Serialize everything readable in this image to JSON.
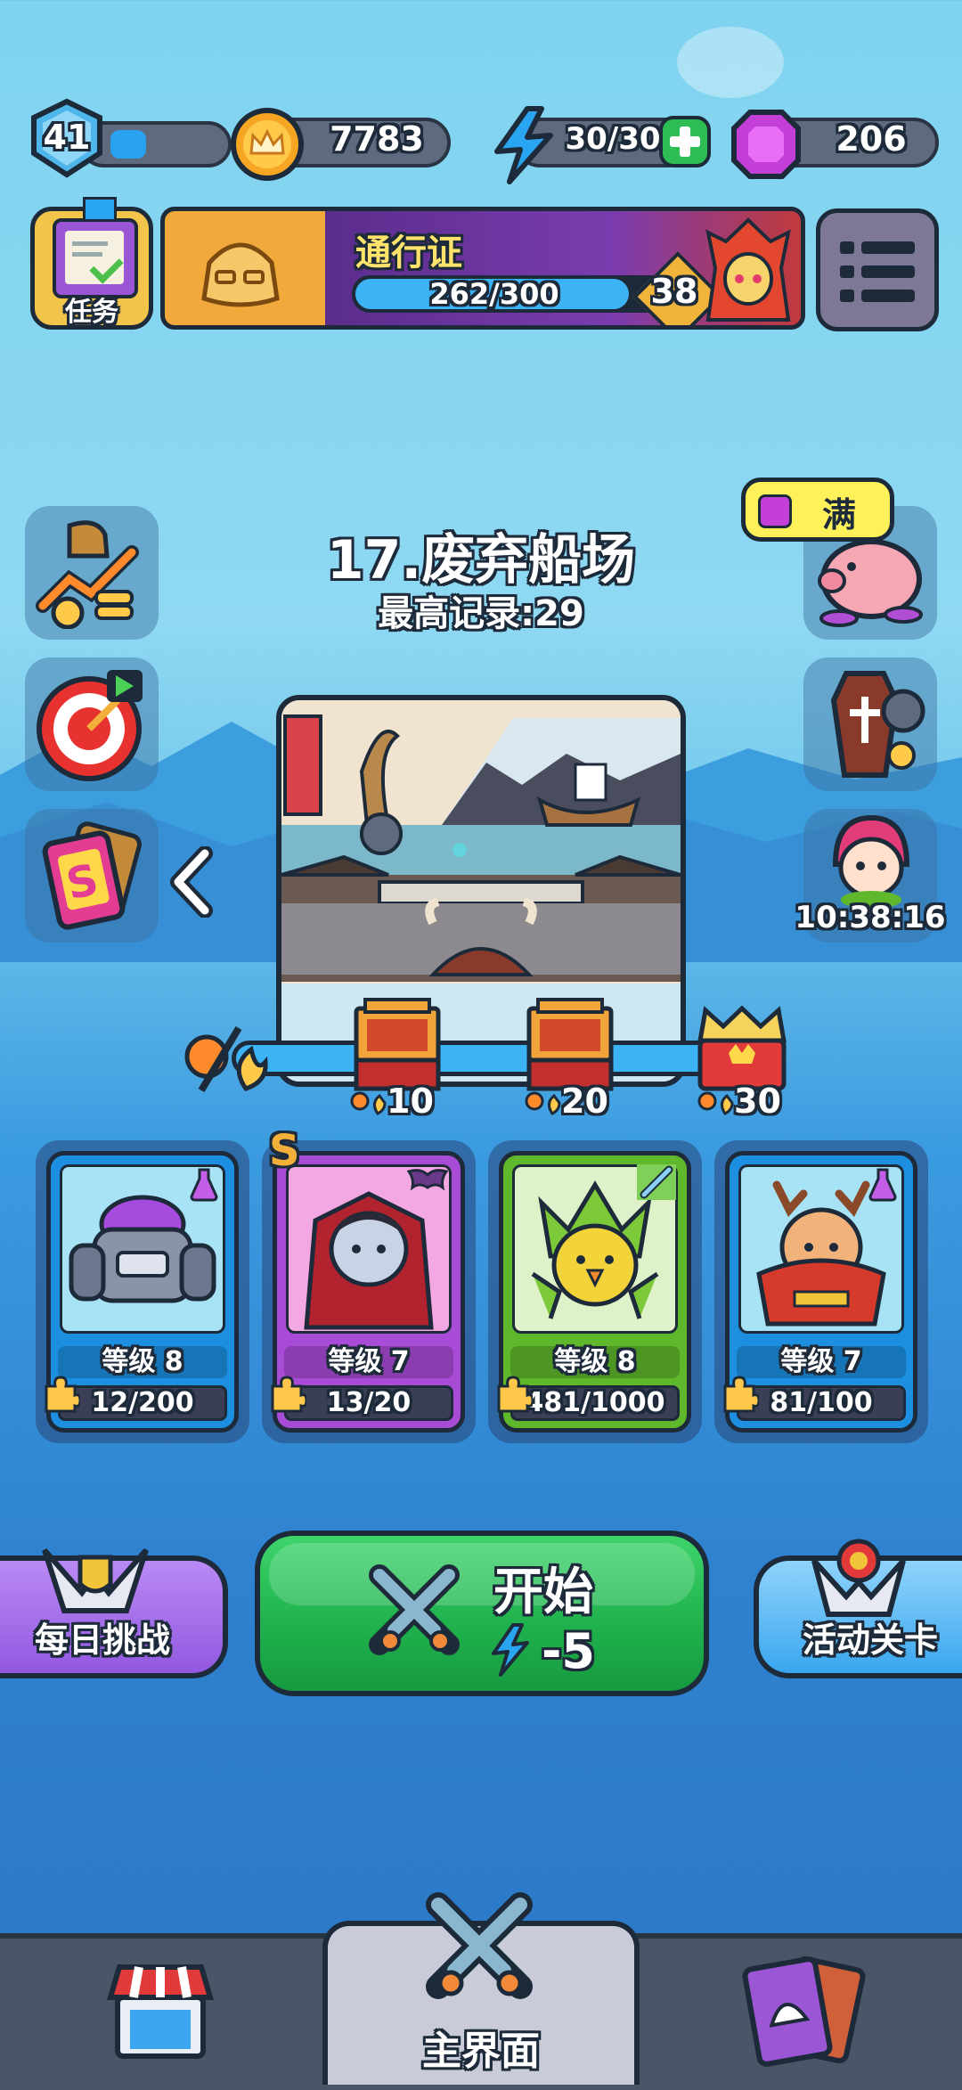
{
  "player": {
    "level": "41"
  },
  "resources": {
    "coins": "7783",
    "energy": "30/30",
    "gems": "206"
  },
  "header": {
    "tasks_label": "任务",
    "pass_title": "通行证",
    "pass_progress": "262/300",
    "pass_level": "38",
    "pass_progress_fraction": 0.873
  },
  "stage": {
    "title": "17.废弃船场",
    "best_record": "最高记录:29"
  },
  "piggy": {
    "status": "满"
  },
  "event_timer": "10:38:16",
  "milestones": [
    {
      "value": "10"
    },
    {
      "value": "20"
    },
    {
      "value": "30"
    }
  ],
  "heroes": [
    {
      "level": "等级 8",
      "progress": "12/200",
      "frame": "#1c8fe0",
      "bg": "#a7e3f5",
      "badge": "potion-icon"
    },
    {
      "level": "等级 7",
      "progress": "13/20",
      "frame": "#a84bd6",
      "bg": "#f3a8e3",
      "badge": "bat-icon",
      "rank": "S"
    },
    {
      "level": "等级 8",
      "progress": "481/1000",
      "frame": "#5fb82c",
      "bg": "#dff1c8",
      "badge": "sword-icon"
    },
    {
      "level": "等级 7",
      "progress": "81/100",
      "frame": "#1c8fe0",
      "bg": "#a7e3f5",
      "badge": "potion-icon"
    }
  ],
  "buttons": {
    "daily_challenge": "每日挑战",
    "start": "开始",
    "start_cost": "-5",
    "event_stage": "活动关卡"
  },
  "nav": {
    "main": "主界面"
  }
}
